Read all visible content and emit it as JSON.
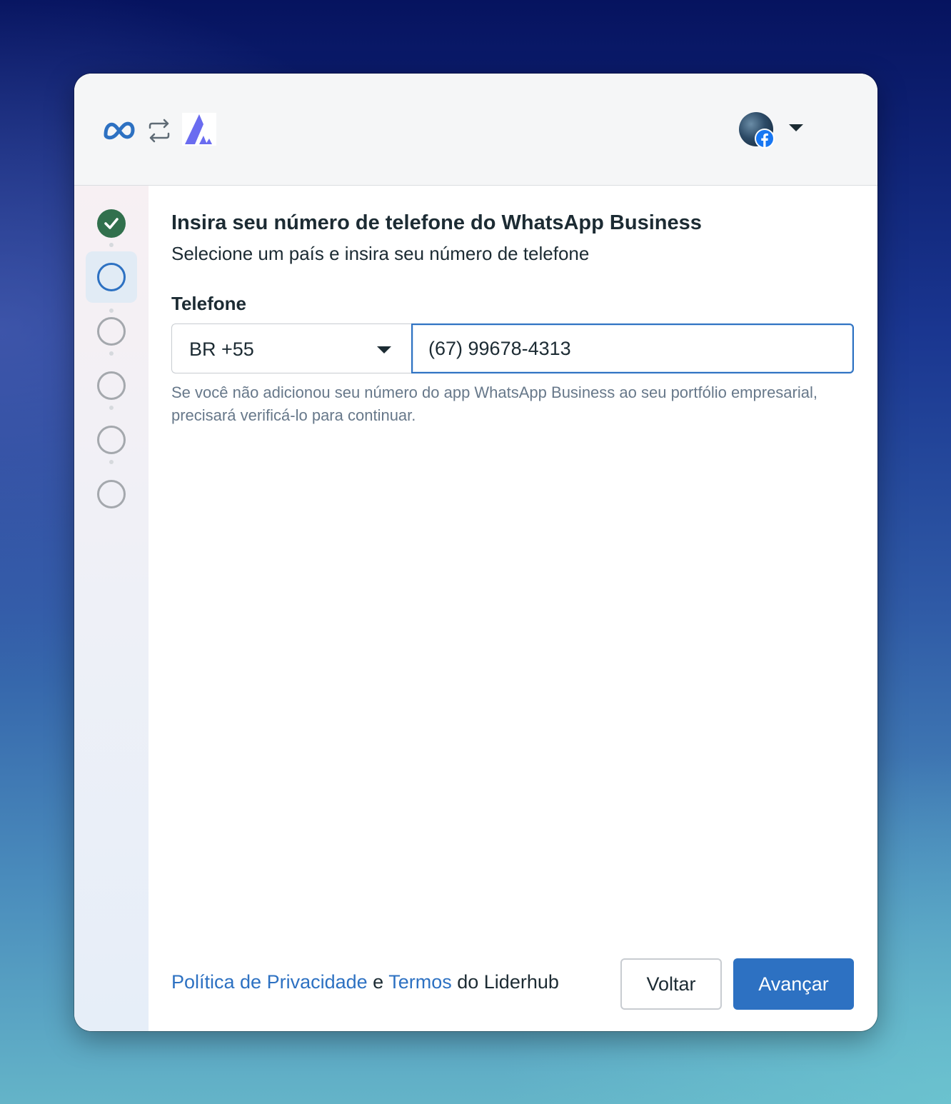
{
  "header": {
    "icons": [
      "meta-logo",
      "swap-icon",
      "app-logo",
      "avatar",
      "facebook-icon",
      "caret-down-icon"
    ]
  },
  "steps": [
    {
      "state": "completed"
    },
    {
      "state": "current"
    },
    {
      "state": "pending"
    },
    {
      "state": "pending"
    },
    {
      "state": "pending"
    },
    {
      "state": "pending"
    }
  ],
  "main": {
    "title": "Insira seu número de telefone do WhatsApp Business",
    "subtitle": "Selecione um país e insira seu número de telefone",
    "phone": {
      "label": "Telefone",
      "country": "BR +55",
      "number": "(67) 99678-4313"
    },
    "help_text": "Se você não adicionou seu número do app WhatsApp Business ao seu portfólio empresarial, precisará verificá-lo para continuar."
  },
  "footer": {
    "privacy_link": "Política de Privacidade",
    "connector": "e",
    "terms_link": "Termos",
    "suffix": "do Liderhub",
    "back_label": "Voltar",
    "next_label": "Avançar"
  },
  "colors": {
    "accent": "#2d71c2",
    "step_done": "#31704d",
    "text": "#1c2b33",
    "muted": "#67788a"
  }
}
